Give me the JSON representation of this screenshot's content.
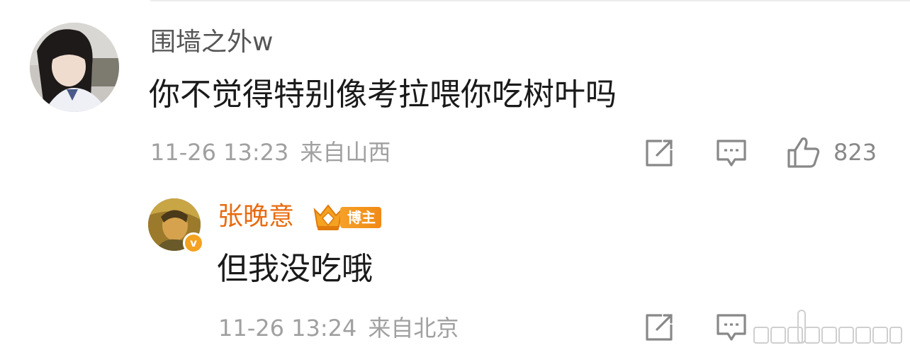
{
  "main_comment": {
    "username": "围墙之外w",
    "text": "你不觉得特别像考拉喂你吃树叶吗",
    "time": "11-26 13:23",
    "location": "来自山西",
    "like_count": "823"
  },
  "reply": {
    "username": "张晚意",
    "badge_label": "博主",
    "text": "但我没吃哦",
    "time": "11-26 13:24",
    "location": "来自北京"
  },
  "colors": {
    "username_reply": "#e86b10",
    "badge": "#f08a16",
    "meta": "#a0a0a0",
    "icon": "#888888"
  }
}
